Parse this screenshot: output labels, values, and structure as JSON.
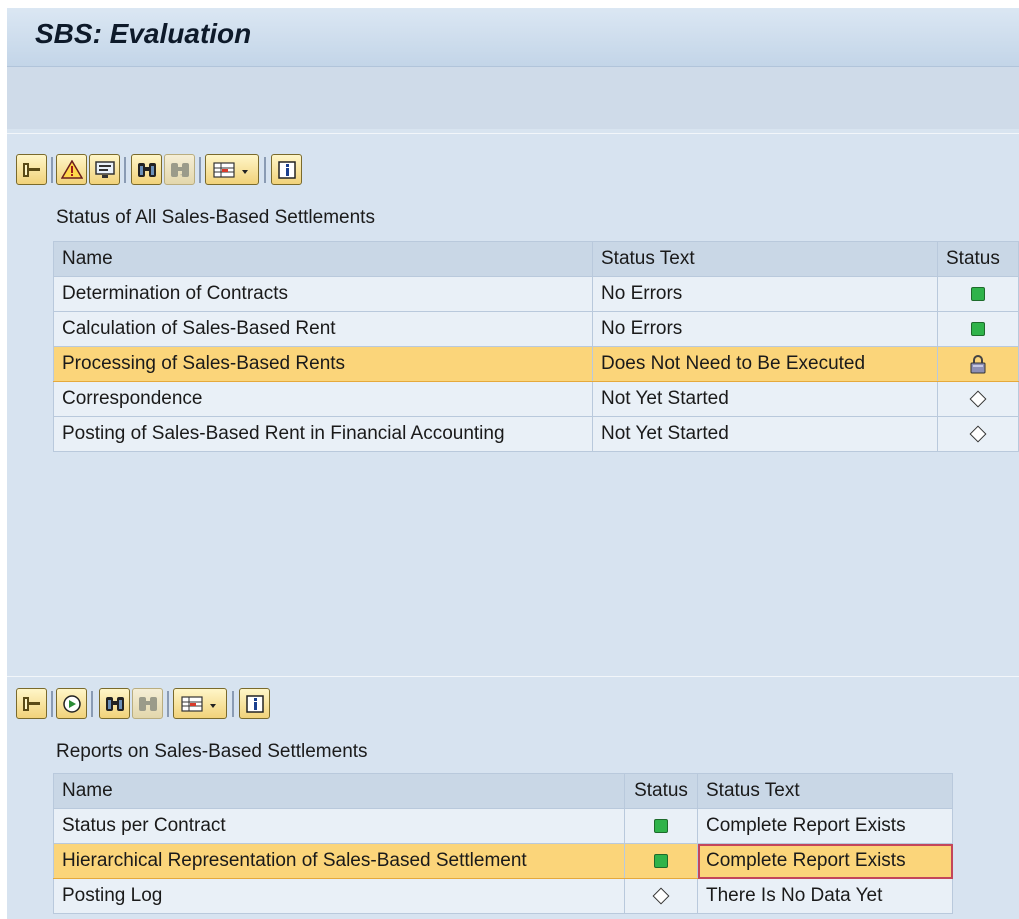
{
  "window": {
    "title": "SBS: Evaluation"
  },
  "panel1": {
    "toolbar": [
      "expand-collapse-icon",
      "alert-icon",
      "display-icon",
      "find-icon",
      "find-next-icon",
      "layout-icon",
      "info-icon"
    ],
    "title": "Status of All Sales-Based Settlements",
    "columns": {
      "name": "Name",
      "status_text": "Status Text",
      "status": "Status"
    },
    "rows": [
      {
        "name": "Determination of Contracts",
        "status_text": "No Errors",
        "status": "green-led-icon"
      },
      {
        "name": "Calculation of Sales-Based Rent",
        "status_text": "No Errors",
        "status": "green-led-icon"
      },
      {
        "name": "Processing of Sales-Based Rents",
        "status_text": "Does Not Need to Be Executed",
        "status": "lock-icon",
        "selected": true
      },
      {
        "name": "Correspondence",
        "status_text": "Not Yet Started",
        "status": "diamond-icon"
      },
      {
        "name": "Posting of Sales-Based Rent in Financial Accounting",
        "status_text": "Not Yet Started",
        "status": "diamond-icon"
      }
    ]
  },
  "panel2": {
    "toolbar": [
      "expand-collapse-icon",
      "execute-icon",
      "find-icon",
      "find-next-icon",
      "layout-icon",
      "info-icon"
    ],
    "title": "Reports on Sales-Based Settlements",
    "columns": {
      "name": "Name",
      "status": "Status",
      "status_text": "Status Text"
    },
    "rows": [
      {
        "name": "Status per Contract",
        "status": "green-led-icon",
        "status_text": "Complete Report Exists"
      },
      {
        "name": "Hierarchical Representation of Sales-Based Settlement",
        "status": "green-led-icon",
        "status_text": "Complete Report Exists",
        "selected": true
      },
      {
        "name": "Posting Log",
        "status": "diamond-icon",
        "status_text": "There Is No Data Yet"
      }
    ]
  },
  "colors": {
    "selected_row": "#fbd57a",
    "ok_led": "#2fb34a",
    "background": "#d8e4f0"
  }
}
